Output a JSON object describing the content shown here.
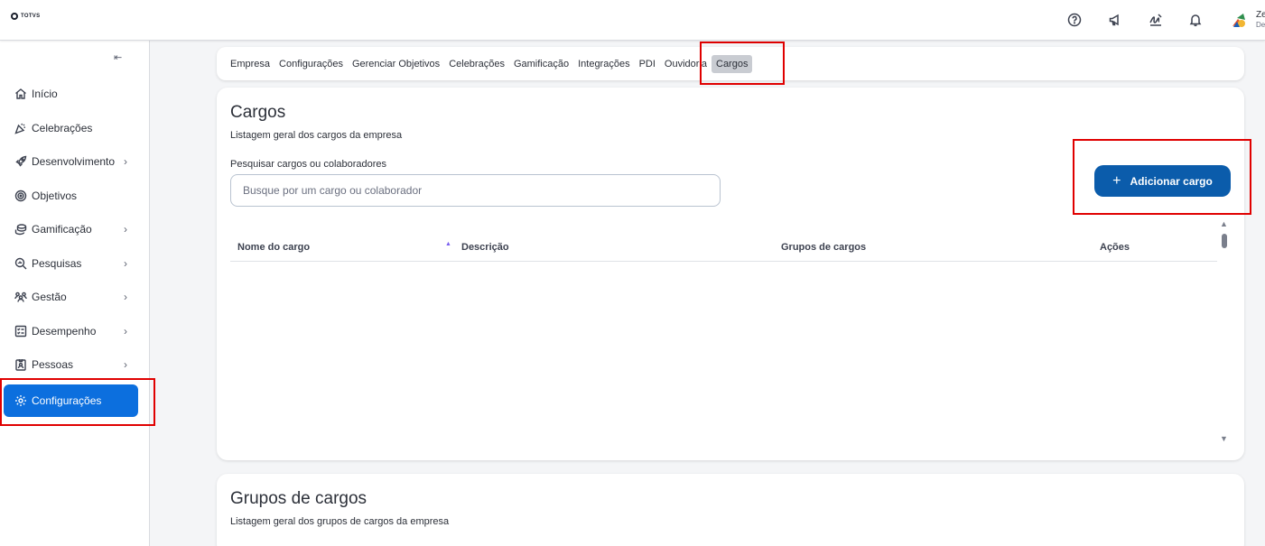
{
  "header": {
    "logo_text": "TOTVS",
    "icons": [
      "help-icon",
      "megaphone-icon",
      "signature-icon",
      "bell-icon"
    ],
    "user": {
      "name": "Ze",
      "role": "De"
    }
  },
  "sidebar": {
    "collapse_icon": "⇤",
    "items": [
      {
        "label": "Início",
        "icon": "home-icon",
        "has_children": false
      },
      {
        "label": "Celebrações",
        "icon": "party-icon",
        "has_children": false
      },
      {
        "label": "Desenvolvimento",
        "icon": "rocket-icon",
        "has_children": true
      },
      {
        "label": "Objetivos",
        "icon": "target-icon",
        "has_children": false
      },
      {
        "label": "Gamificação",
        "icon": "coins-icon",
        "has_children": true
      },
      {
        "label": "Pesquisas",
        "icon": "search-chart-icon",
        "has_children": true
      },
      {
        "label": "Gestão",
        "icon": "people-icon",
        "has_children": true
      },
      {
        "label": "Desempenho",
        "icon": "checklist-icon",
        "has_children": true
      },
      {
        "label": "Pessoas",
        "icon": "badge-icon",
        "has_children": true
      },
      {
        "label": "Configurações",
        "icon": "gear-icon",
        "has_children": false,
        "active": true
      }
    ]
  },
  "tabs": [
    {
      "label": "Empresa"
    },
    {
      "label": "Configurações"
    },
    {
      "label": "Gerenciar Objetivos"
    },
    {
      "label": "Celebrações"
    },
    {
      "label": "Gamificação"
    },
    {
      "label": "Integrações"
    },
    {
      "label": "PDI"
    },
    {
      "label": "Ouvidoria"
    },
    {
      "label": "Cargos",
      "selected": true
    }
  ],
  "cargos": {
    "title": "Cargos",
    "subtitle": "Listagem geral dos cargos da empresa",
    "search_label": "Pesquisar cargos ou colaboradores",
    "search_placeholder": "Busque por um cargo ou colaborador",
    "search_value": "",
    "add_button_label": "Adicionar cargo",
    "table": {
      "columns": [
        "Nome do cargo",
        "Descrição",
        "Grupos de cargos",
        "Ações"
      ],
      "sort_column": "Nome do cargo",
      "rows": []
    }
  },
  "grupos": {
    "title": "Grupos de cargos",
    "subtitle": "Listagem geral dos grupos de cargos da empresa"
  },
  "colors": {
    "accent": "#0c6fde",
    "button": "#0b5cab",
    "highlight": "#e00000"
  }
}
